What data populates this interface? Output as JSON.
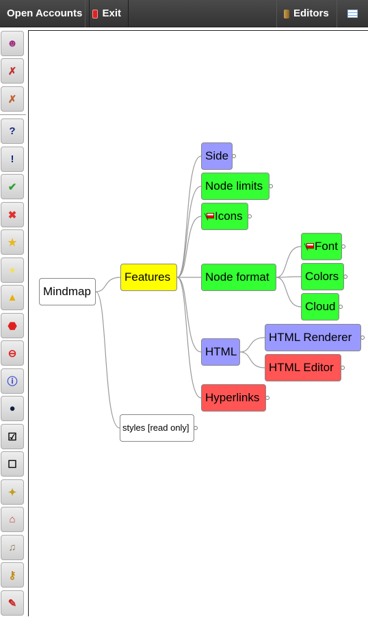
{
  "topbar": {
    "open_accounts": "Open Accounts",
    "exit": "Exit",
    "editors": "Editors",
    "menu_icon": "list-icon",
    "exit_icon": "power-icon",
    "editors_icon": "door-icon"
  },
  "sidebar": {
    "items": [
      {
        "icon": "idea-icon",
        "glyph": "☻",
        "color": "#a03080"
      },
      {
        "icon": "remove-first-icon",
        "glyph": "✗",
        "color": "#c03030"
      },
      {
        "icon": "remove-last-icon",
        "glyph": "✗",
        "color": "#c06030"
      },
      {
        "icon": "question-icon",
        "glyph": "?",
        "color": "#102a80"
      },
      {
        "icon": "exclamation-icon",
        "glyph": "!",
        "color": "#102a80"
      },
      {
        "icon": "check-icon",
        "glyph": "✔",
        "color": "#30a030"
      },
      {
        "icon": "cross-icon",
        "glyph": "✖",
        "color": "#e03030"
      },
      {
        "icon": "star-icon",
        "glyph": "★",
        "color": "#e8b820"
      },
      {
        "icon": "bulb-icon",
        "glyph": "●",
        "color": "#f0e060"
      },
      {
        "icon": "warning-icon",
        "glyph": "▲",
        "color": "#e8b000"
      },
      {
        "icon": "stop-icon",
        "glyph": "⬣",
        "color": "#e02020"
      },
      {
        "icon": "minus-icon",
        "glyph": "⊖",
        "color": "#e02020"
      },
      {
        "icon": "info-icon",
        "glyph": "ⓘ",
        "color": "#3040d0"
      },
      {
        "icon": "bomb-icon",
        "glyph": "●",
        "color": "#102040"
      },
      {
        "icon": "checkbox-checked-icon",
        "glyph": "☑",
        "color": "#000"
      },
      {
        "icon": "checkbox-empty-icon",
        "glyph": "☐",
        "color": "#000"
      },
      {
        "icon": "magic-wand-icon",
        "glyph": "✦",
        "color": "#c0a020"
      },
      {
        "icon": "home-icon",
        "glyph": "⌂",
        "color": "#c04040"
      },
      {
        "icon": "music-icon",
        "glyph": "♫",
        "color": "#8a8060"
      },
      {
        "icon": "key-icon",
        "glyph": "⚷",
        "color": "#c08a10"
      },
      {
        "icon": "pencil-icon",
        "glyph": "✎",
        "color": "#d02020"
      }
    ]
  },
  "colors": {
    "blue": "#9999ff",
    "green": "#33ff33",
    "red": "#ff5555",
    "yellow": "#ffff00",
    "white": "#ffffff"
  },
  "mindmap": {
    "nodes": [
      {
        "id": "root",
        "label": "Mindmap",
        "color": "#ffffff",
        "parent": null,
        "folded": false
      },
      {
        "id": "features",
        "label": "Features",
        "color": "#ffff00",
        "parent": "root",
        "folded": false
      },
      {
        "id": "side",
        "label": "Side",
        "color": "#9999ff",
        "parent": "features",
        "folded": true
      },
      {
        "id": "limits",
        "label": "Node limits",
        "color": "#33ff33",
        "parent": "features",
        "folded": true
      },
      {
        "id": "icons",
        "label": "Icons",
        "color": "#33ff33",
        "parent": "features",
        "folded": true,
        "icon": "flag-icon"
      },
      {
        "id": "format",
        "label": "Node format",
        "color": "#33ff33",
        "parent": "features",
        "folded": false
      },
      {
        "id": "font",
        "label": "Font",
        "color": "#33ff33",
        "parent": "format",
        "folded": true,
        "icon": "flag-icon"
      },
      {
        "id": "colors",
        "label": "Colors",
        "color": "#33ff33",
        "parent": "format",
        "folded": true
      },
      {
        "id": "cloud",
        "label": "Cloud",
        "color": "#33ff33",
        "parent": "format",
        "folded": true
      },
      {
        "id": "html",
        "label": "HTML",
        "color": "#9999ff",
        "parent": "features",
        "folded": false
      },
      {
        "id": "renderer",
        "label": "HTML Renderer",
        "color": "#9999ff",
        "parent": "html",
        "folded": true
      },
      {
        "id": "editor",
        "label": "HTML Editor",
        "color": "#ff5555",
        "parent": "html",
        "folded": true
      },
      {
        "id": "links",
        "label": "Hyperlinks",
        "color": "#ff5555",
        "parent": "features",
        "folded": true
      },
      {
        "id": "styles",
        "label": "styles [read only]",
        "color": "#ffffff",
        "parent": "root",
        "folded": true
      }
    ]
  }
}
